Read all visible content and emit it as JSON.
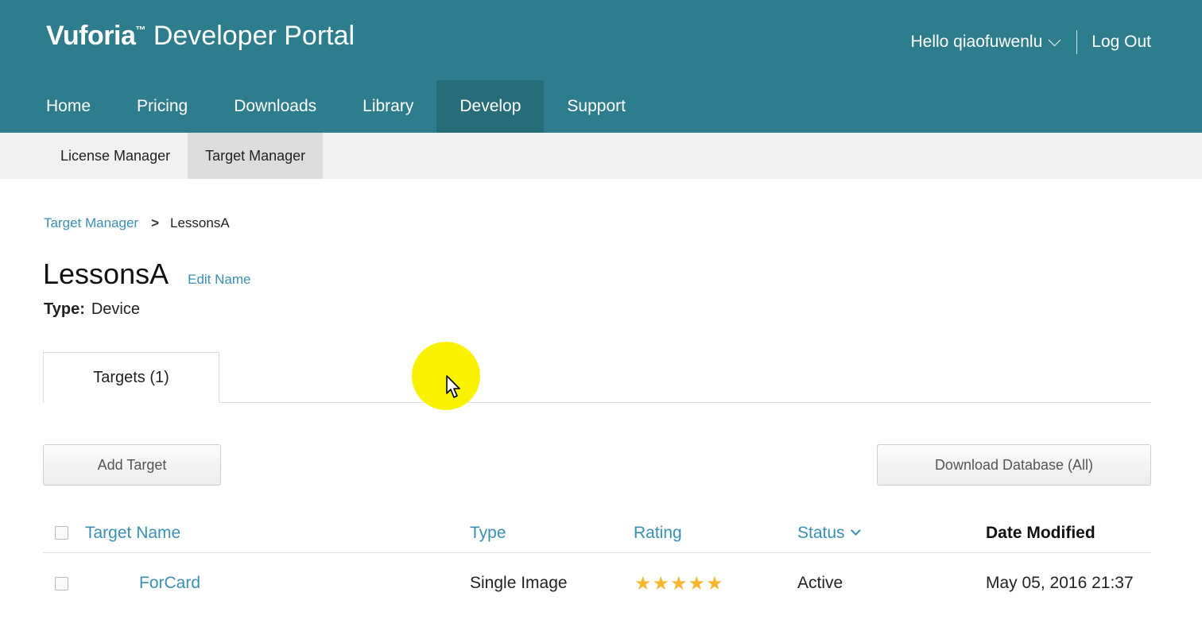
{
  "header": {
    "brand_bold": "Vuforia",
    "brand_tm": "™",
    "brand_rest": " Developer Portal",
    "user_greeting": "Hello qiaofuwenlu",
    "logout": "Log Out"
  },
  "main_nav": [
    {
      "label": "Home"
    },
    {
      "label": "Pricing"
    },
    {
      "label": "Downloads"
    },
    {
      "label": "Library"
    },
    {
      "label": "Develop",
      "active": true
    },
    {
      "label": "Support"
    }
  ],
  "sub_nav": [
    {
      "label": "License Manager"
    },
    {
      "label": "Target Manager",
      "active": true
    }
  ],
  "breadcrumb": {
    "parent": "Target Manager",
    "separator": ">",
    "current": "LessonsA"
  },
  "database": {
    "name": "LessonsA",
    "edit_label": "Edit Name",
    "type_label": "Type:",
    "type_value": "Device"
  },
  "tabs": [
    {
      "label": "Targets (1)",
      "active": true
    }
  ],
  "actions": {
    "add_target": "Add Target",
    "download_database": "Download Database (All)"
  },
  "table": {
    "columns": {
      "target_name": "Target Name",
      "type": "Type",
      "rating": "Rating",
      "status": "Status",
      "date_modified": "Date Modified"
    },
    "rows": [
      {
        "target_name": "ForCard",
        "type": "Single Image",
        "rating": 5,
        "rating_stars": "★★★★★",
        "status": "Active",
        "date_modified": "May 05, 2016 21:37"
      }
    ]
  },
  "colors": {
    "header_bg": "#2e7d8c",
    "nav_active_bg": "#266c79",
    "link": "#3a8fb4",
    "star": "#f5b731",
    "cursor_highlight": "#f8f200"
  }
}
